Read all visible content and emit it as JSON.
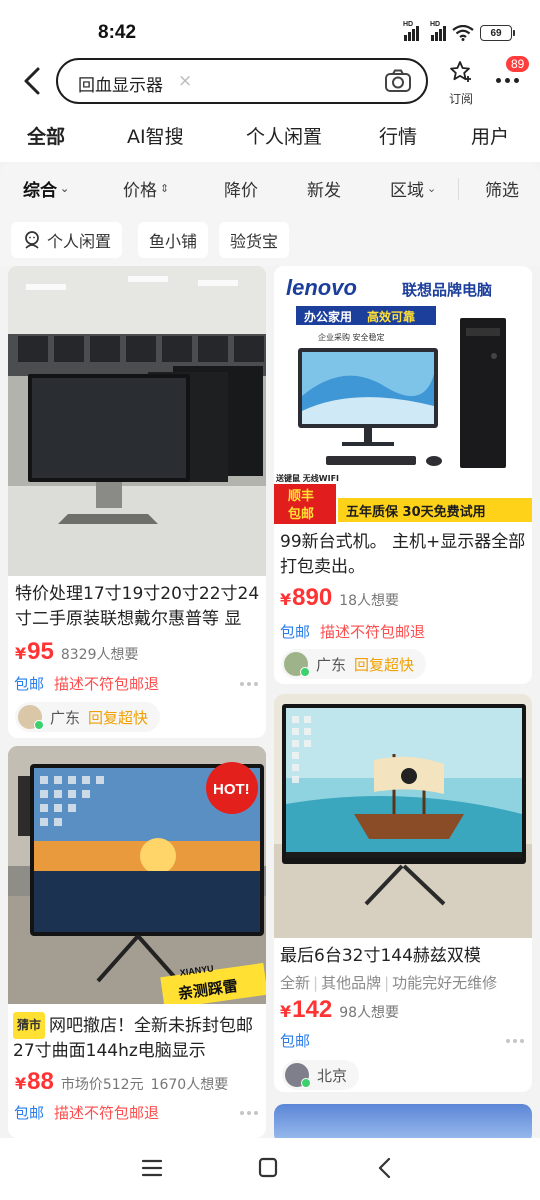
{
  "status": {
    "time": "8:42",
    "hd1": "HD",
    "hd2": "HD",
    "battery": "69"
  },
  "search": {
    "query": "回血显示器",
    "clear": "×"
  },
  "header": {
    "subscribe_label": "订阅",
    "more_badge": "89"
  },
  "tabs": [
    "全部",
    "AI智搜",
    "个人闲置",
    "行情",
    "用户"
  ],
  "filters": {
    "comprehensive": "综合",
    "price": "价格",
    "price_drop": "降价",
    "new": "新发",
    "region": "区域",
    "filter": "筛选"
  },
  "chips": [
    "个人闲置",
    "鱼小铺",
    "验货宝"
  ],
  "items": [
    {
      "title": "特价处理17寸19寸20寸22寸24寸二手原装联想戴尔惠普等 显",
      "price": "95",
      "want": "8329人想要",
      "tag_blue": "包邮",
      "tag_red": "描述不符包邮退",
      "location": "广东",
      "reply": "回复超快"
    },
    {
      "title": "99新台式机。 主机+显示器全部打包卖出。",
      "price": "890",
      "want": "18人想要",
      "tag_blue": "包邮",
      "tag_red": "描述不符包邮退",
      "location": "广东",
      "reply": "回复超快",
      "ad": {
        "brand": "lenovo",
        "brand_cn": "联想品牌电脑",
        "line1": "办公家用",
        "line2": "高效可靠",
        "line3": "企业采购  安全稳定",
        "kb": "送键鼠 无线WIFI",
        "sf1": "顺丰",
        "sf2": "包邮",
        "warranty": "五年质保 30天免费试用"
      }
    },
    {
      "shop_badge": "猜市",
      "title": "网吧撤店！全新未拆封包邮27寸曲面144hz电脑显示",
      "price": "88",
      "market": "市场价512元",
      "want": "1670人想要",
      "tag_blue": "包邮",
      "tag_red": "描述不符包邮退",
      "hot": "HOT!",
      "stamp_top": "XIANYU",
      "stamp": "亲测踩雷"
    },
    {
      "title": "最后6台32寸144赫兹双模",
      "attrs": [
        "全新",
        "其他品牌",
        "功能完好无维修"
      ],
      "price": "142",
      "want": "98人想要",
      "tag_blue": "包邮",
      "location": "北京"
    }
  ],
  "colors": {
    "price": "#ff3333",
    "accent": "#ffe733",
    "tag_blue": "#2a7de8",
    "badge": "#ff3d3d"
  }
}
